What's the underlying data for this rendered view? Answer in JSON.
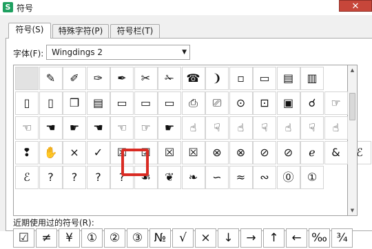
{
  "window": {
    "title": "符号",
    "icon_letter": "S",
    "close_glyph": "✕",
    "accent_color": "#1fa060",
    "close_color": "#c7463a"
  },
  "tabs": [
    {
      "label": "符号(S)",
      "active": true
    },
    {
      "label": "特殊字符(P)",
      "active": false
    },
    {
      "label": "符号栏(T)",
      "active": false
    }
  ],
  "font": {
    "label": "字体(F):",
    "value": "Wingdings 2"
  },
  "symbols": [
    [
      "",
      "✎",
      "✐",
      "✑",
      "✒",
      "✂",
      "✁",
      "☎",
      "❩",
      "▫",
      "▭",
      "▤",
      "▥"
    ],
    [
      "▯",
      "▯",
      "❒",
      "▤",
      "▭",
      "▭",
      "▭",
      "⎙",
      "⎚",
      "⊙",
      "⊡",
      "▣",
      "☌",
      "☞"
    ],
    [
      "☜",
      "☚",
      "☛",
      "☚",
      "☜",
      "☞",
      "☛",
      "☝",
      "☟",
      "☝",
      "☟",
      "☝",
      "☟",
      "☝"
    ],
    [
      "❢",
      "✋",
      "×",
      "✓",
      "☒",
      "☑",
      "☒",
      "☒",
      "⊗",
      "⊗",
      "⊘",
      "⊘",
      "ℯ",
      "&",
      "ℰ"
    ],
    [
      "ℰ",
      "?",
      "?",
      "?",
      "?",
      "☙",
      "❦",
      "❧",
      "∽",
      "≈",
      "∾",
      "⓪",
      "①"
    ]
  ],
  "selected_symbol": "☑",
  "recent": {
    "label": "近期使用过的符号(R):",
    "items": [
      "☑",
      "≠",
      "¥",
      "①",
      "②",
      "③",
      "№",
      "√",
      "×",
      "↓",
      "→",
      "↑",
      "←",
      "‰",
      "¾"
    ]
  }
}
